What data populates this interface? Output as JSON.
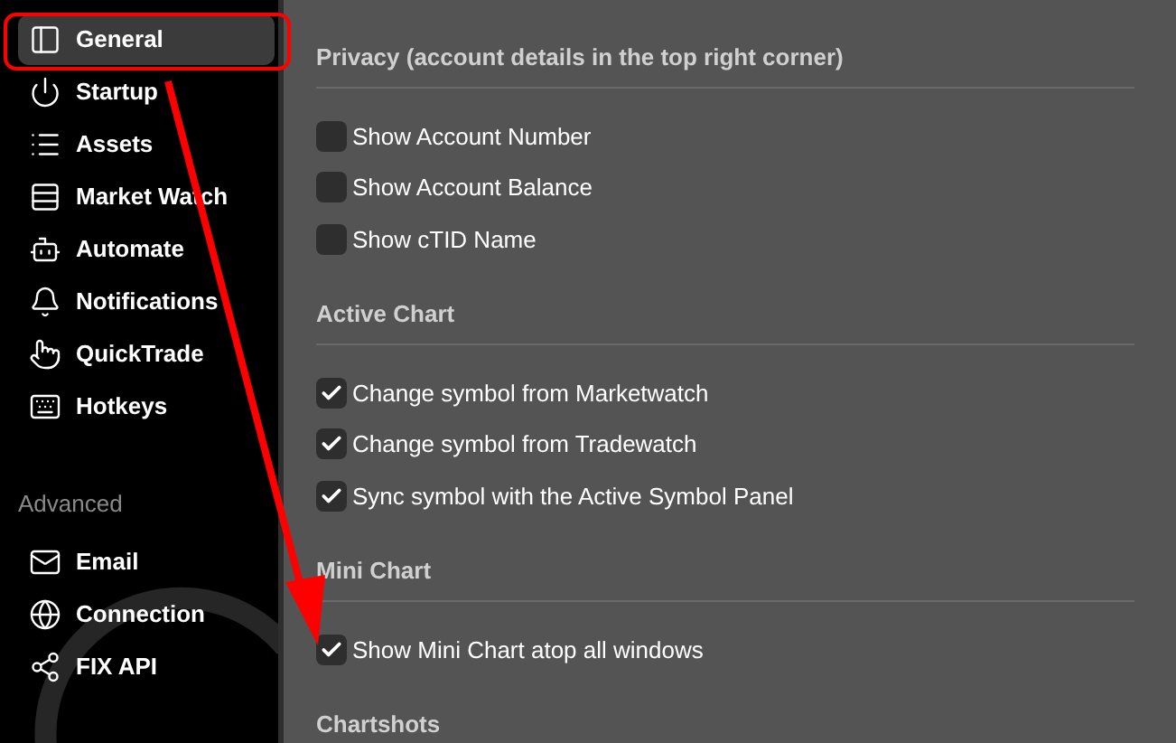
{
  "sidebar": {
    "items": [
      {
        "label": "General",
        "selected": true
      },
      {
        "label": "Startup",
        "selected": false
      },
      {
        "label": "Assets",
        "selected": false
      },
      {
        "label": "Market Watch",
        "selected": false
      },
      {
        "label": "Automate",
        "selected": false
      },
      {
        "label": "Notifications",
        "selected": false
      },
      {
        "label": "QuickTrade",
        "selected": false
      },
      {
        "label": "Hotkeys",
        "selected": false
      }
    ],
    "group_title": "Advanced",
    "advanced_items": [
      {
        "label": "Email",
        "selected": false
      },
      {
        "label": "Connection",
        "selected": false
      },
      {
        "label": "FIX API",
        "selected": false
      }
    ]
  },
  "sections": [
    {
      "title": "Privacy (account details in the top right corner)",
      "options": [
        {
          "label": "Show Account Number",
          "checked": false
        },
        {
          "label": "Show Account Balance",
          "checked": false
        },
        {
          "label": "Show cTID Name",
          "checked": false
        }
      ]
    },
    {
      "title": "Active Chart",
      "options": [
        {
          "label": "Change symbol from Marketwatch",
          "checked": true
        },
        {
          "label": "Change symbol from Tradewatch",
          "checked": true
        },
        {
          "label": "Sync symbol with the Active Symbol Panel",
          "checked": true
        }
      ]
    },
    {
      "title": "Mini Chart",
      "options": [
        {
          "label": "Show Mini Chart atop all windows",
          "checked": true
        }
      ]
    },
    {
      "title": "Chartshots"
    }
  ]
}
